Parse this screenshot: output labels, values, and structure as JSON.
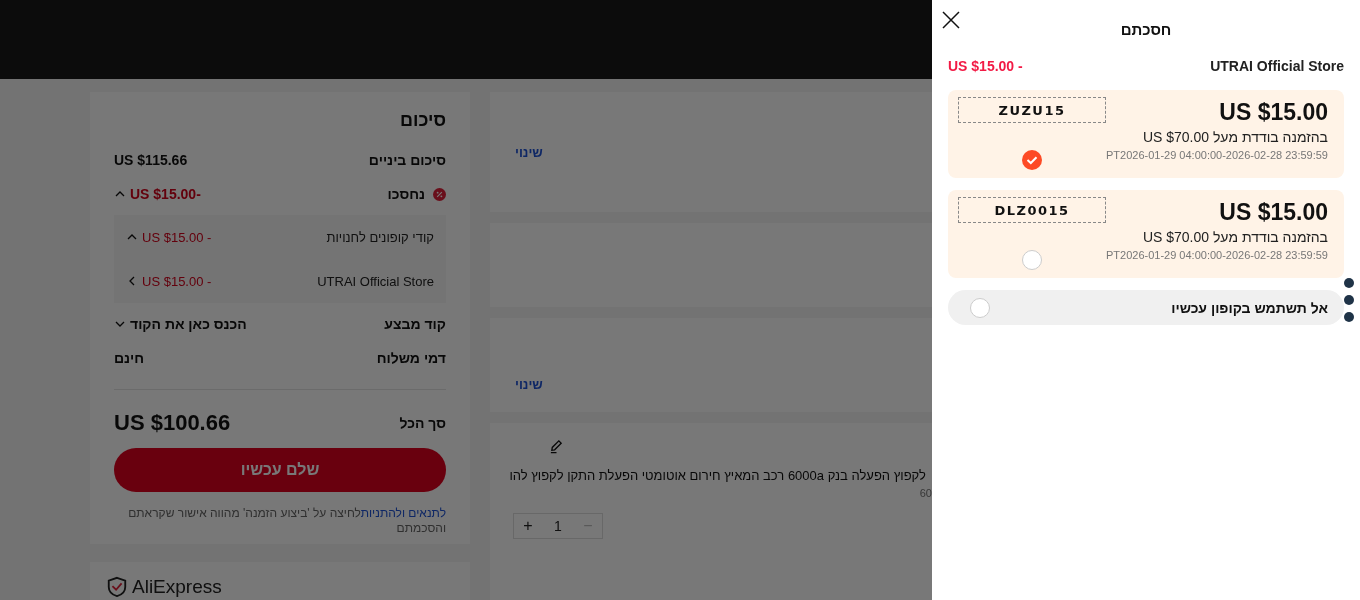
{
  "order_summary": {
    "title": "סיכום",
    "subtotal": {
      "label": "סיכום ביניים",
      "value": "US $115.66"
    },
    "savings": {
      "label": "נחסכו",
      "value": "US $15.00-",
      "expanded": true,
      "items": [
        {
          "label": "קודי קופונים לחנויות",
          "value": "US $15.00 -",
          "expanded": true
        },
        {
          "label": "UTRAI Official Store",
          "value": "US $15.00 -",
          "expanded": false
        }
      ]
    },
    "promo_code": {
      "label": "קוד מבצע",
      "value": "הכנס כאן את הקוד",
      "expanded": false
    },
    "shipping": {
      "label": "דמי משלוח",
      "value": "חינם"
    },
    "total": {
      "label": "סך הכל",
      "value": "US $100.66"
    },
    "pay_button": "שלם עכשיו",
    "terms": {
      "link": "לתנאים ולהתניות",
      "text": "לחיצה על 'ביצוע הזמנה' מהווה אישור שקראתם והסכמתם"
    }
  },
  "logo": "AliExpress",
  "address_card": {
    "link": "שינוי"
  },
  "payment_card": {
    "link": "שינוי"
  },
  "product": {
    "title": "לקפוץ הפעלה בנק 6000a רכב המאיץ חירום אוטומטי הפעלת התקן לקפוץ להו",
    "note": "60",
    "increase": "+",
    "quantity": "1",
    "decrease": "−",
    "decrease_disabled": true
  },
  "drawer": {
    "title": "חסכתם",
    "store": "UTRAI Official Store",
    "discount": "US $15.00 -",
    "coupons": [
      {
        "amount": "US $15.00",
        "condition": "בהזמנה בודדת מעל US $70.00",
        "validity": "PT2026-01-29 04:00:00-2026-02-28 23:59:59",
        "code": "ZUZU15",
        "selected": true
      },
      {
        "amount": "US $15.00",
        "condition": "בהזמנה בודדת מעל US $70.00",
        "validity": "PT2026-01-29 04:00:00-2026-02-28 23:59:59",
        "code": "DLZ0015",
        "selected": false
      }
    ],
    "no_coupon": {
      "label": "אל תשתמש בקופון עכשיו",
      "selected": false
    }
  }
}
